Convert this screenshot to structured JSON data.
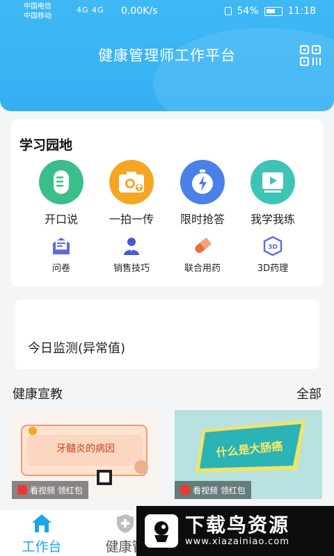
{
  "status_bar": {
    "carrier_1": "中国电信",
    "carrier_2": "中国移动",
    "network": "4G 4G",
    "speed": "0.00K/s",
    "battery": "54%",
    "time": "11:18"
  },
  "header": {
    "title": "健康管理师工作平台",
    "qr_icon": "qr-code-icon"
  },
  "study": {
    "title": "学习园地",
    "main_items": [
      {
        "label": "开口说",
        "icon": "speak-icon",
        "color": "#3bbf8a"
      },
      {
        "label": "一拍一传",
        "icon": "camera-upload-icon",
        "color": "#f5a623"
      },
      {
        "label": "限时抢答",
        "icon": "timer-icon",
        "color": "#4a80e8"
      },
      {
        "label": "我学我练",
        "icon": "video-play-icon",
        "color": "#3ec4b5"
      }
    ],
    "sub_items": [
      {
        "label": "问卷",
        "icon": "survey-icon"
      },
      {
        "label": "销售技巧",
        "icon": "sales-icon"
      },
      {
        "label": "联合用药",
        "icon": "pill-icon"
      },
      {
        "label": "3D药理",
        "icon": "3d-icon"
      }
    ]
  },
  "monitor": {
    "label": "今日监测(异常值)"
  },
  "education": {
    "title": "健康宣教",
    "all": "全部",
    "cards": [
      {
        "title": "牙髓炎的病因",
        "badge": "看视频 领红包"
      },
      {
        "title": "什么是大肠癌",
        "badge": "看视频 领红包"
      }
    ]
  },
  "bottom_nav": {
    "items": [
      {
        "label": "工作台",
        "active": true
      },
      {
        "label": "健康管",
        "active": false
      }
    ]
  },
  "watermark": {
    "title": "下载鸟资源",
    "url": "www.xiazainiao.com"
  },
  "colors": {
    "brand": "#34b0f3",
    "active_nav": "#1aa6e8"
  }
}
